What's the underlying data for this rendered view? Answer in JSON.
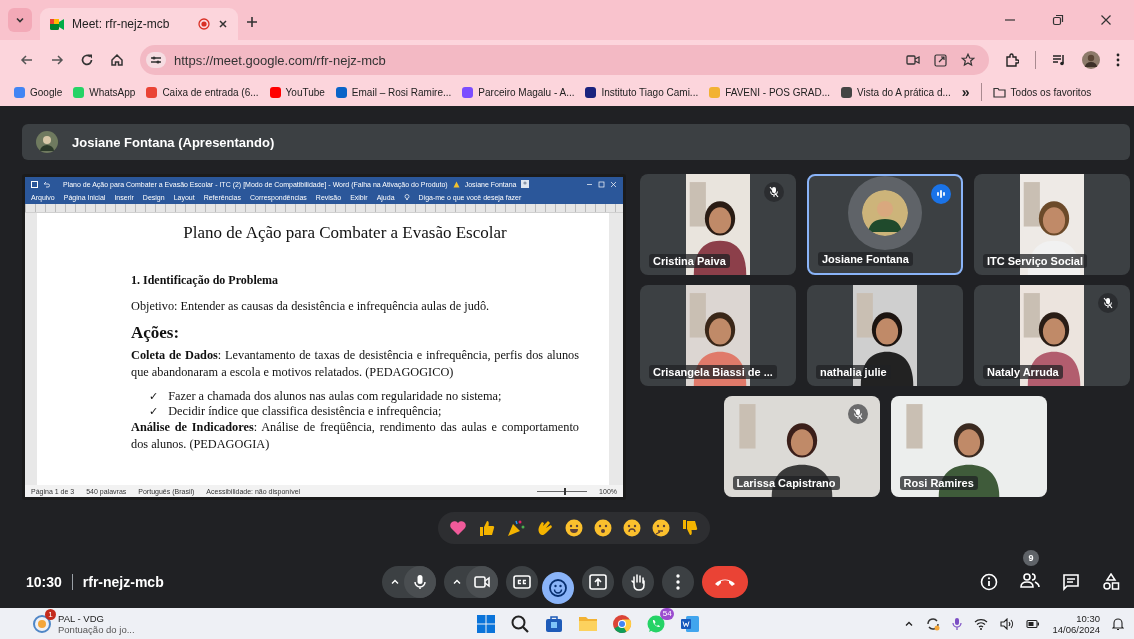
{
  "browser": {
    "tab": {
      "title": "Meet: rfr-nejz-mcb"
    },
    "url": "https://meet.google.com/rfr-nejz-mcb",
    "bookmarks": [
      "Google",
      "WhatsApp",
      "Caixa de entrada (6...",
      "YouTube",
      "Email – Rosi Ramire...",
      "Parceiro Magalu - A...",
      "Instituto Tiago Cami...",
      "FAVENI - POS GRAD...",
      "Vista do A prática d..."
    ],
    "more_bookmarks": "»",
    "all_bookmarks": "Todos os favoritos"
  },
  "meet": {
    "presenter": "Josiane Fontana (Apresentando)",
    "document": {
      "title_bar": "Plano de Ação para Combater a Evasão Escolar - ITC (2) [Modo de Compatibilidade] - Word (Falha na Ativação do Produto)",
      "user": "Josiane Fontana",
      "menu": [
        "Arquivo",
        "Página Inicial",
        "Inserir",
        "Design",
        "Layout",
        "Referências",
        "Correspondências",
        "Revisão",
        "Exibir",
        "Ajuda"
      ],
      "tell_me": "Diga-me o que você deseja fazer",
      "blocks": [
        {
          "kind": "title",
          "text": "Plano de Ação para Combater a Evasão Escolar"
        },
        {
          "kind": "heading",
          "text": "1. Identificação do Problema"
        },
        {
          "kind": "para",
          "text": "Objetivo: Entender as causas da desistência e infrequência aulas de judô."
        },
        {
          "kind": "section",
          "text": "Ações:"
        },
        {
          "kind": "para",
          "text": "**Coleta de Dados**: Levantamento de taxas de desistência e infrequência, perfis dos alunos que abandonaram a escola e motivos relatados. (PEDAGOGICO)"
        },
        {
          "kind": "bullet",
          "mark": "✓",
          "text": "Fazer a chamada dos alunos nas aulas com regularidade no sistema;"
        },
        {
          "kind": "bullet",
          "mark": "✓",
          "text": "Decidir índice que classifica desistência e infrequência;"
        },
        {
          "kind": "para",
          "text": "**Análise de Indicadores**: Análise de freqüência, rendimento das aulas e comportamento dos alunos. (PEDAGOGIA)"
        }
      ],
      "status": [
        "Página 1 de 3",
        "540 palavras",
        "Português (Brasil)",
        "Acessibilidade: não disponível"
      ],
      "zoom_slider": {
        "level": 0.55
      },
      "zoom": "100%"
    },
    "participants": [
      {
        "name": "Cristina Paiva",
        "kind": "portrait",
        "muted": true,
        "speaking": false
      },
      {
        "name": "Josiane Fontana",
        "kind": "avatar",
        "muted": false,
        "speaking": true
      },
      {
        "name": "ITC Serviço Social",
        "kind": "portrait",
        "muted": false,
        "speaking": false
      },
      {
        "name": "Crisangela Biassi de ...",
        "kind": "portrait",
        "muted": false,
        "speaking": false
      },
      {
        "name": "nathalia julie",
        "kind": "portrait",
        "muted": false,
        "speaking": false
      },
      {
        "name": "Nataly Arruda",
        "kind": "portrait",
        "muted": true,
        "speaking": false
      },
      {
        "name": "Larissa Capistrano",
        "kind": "landscape",
        "muted": true,
        "speaking": false
      },
      {
        "name": "Rosi Ramires",
        "kind": "landscape",
        "muted": false,
        "speaking": false
      }
    ],
    "time": "10:30",
    "meeting_code": "rfr-nejz-mcb",
    "people_count": "9",
    "controls": [
      {
        "kind": "mic",
        "active": false
      },
      {
        "kind": "camera",
        "active": false
      },
      {
        "kind": "captions",
        "active": false
      },
      {
        "kind": "reactions",
        "active": true
      },
      {
        "kind": "present",
        "active": false
      },
      {
        "kind": "hand",
        "active": false
      },
      {
        "kind": "more",
        "active": false
      },
      {
        "kind": "end",
        "active": false
      }
    ]
  },
  "taskbar": {
    "notification": {
      "title": "PAL - VDG",
      "subtitle": "Pontuação do jo...",
      "badge": "1"
    },
    "apps": [
      {
        "kind": "start"
      },
      {
        "kind": "search"
      },
      {
        "kind": "store"
      },
      {
        "kind": "files"
      },
      {
        "kind": "chrome"
      },
      {
        "kind": "whatsapp",
        "badge": "54"
      },
      {
        "kind": "word"
      }
    ],
    "time": "10:30",
    "date": "14/06/2024"
  }
}
